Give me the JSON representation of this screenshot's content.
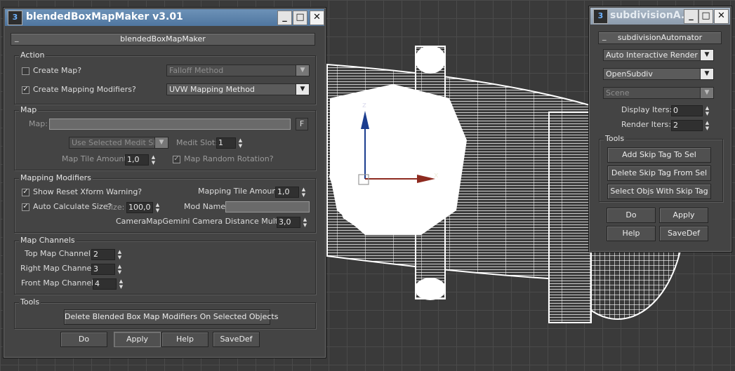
{
  "main_window": {
    "title": "blendedBoxMapMaker v3.01",
    "rollout": "blendedBoxMapMaker",
    "action": {
      "group": "Action",
      "create_map": {
        "label": "Create Map?",
        "checked": false
      },
      "create_mod": {
        "label": "Create Mapping Modifiers?",
        "checked": true
      },
      "falloff_method": "Falloff Method",
      "uvw_method": "UVW Mapping Method"
    },
    "map": {
      "group": "Map",
      "map_label": "Map:",
      "f_button": "F",
      "medit_dropdown": "Use Selected Medit Slot",
      "medit_slot_label": "Medit Slot:",
      "medit_slot_value": "1",
      "tile_label": "Map Tile Amount:",
      "tile_value": "1,0",
      "random_rot_label": "Map Random Rotation?",
      "random_rot_checked": true
    },
    "modifiers": {
      "group": "Mapping Modifiers",
      "reset_xform": {
        "label": "Show Reset Xform Warning?",
        "checked": true
      },
      "auto_calc": {
        "label": "Auto Calculate Size?",
        "checked": true
      },
      "tile_label": "Mapping Tile Amount:",
      "tile_value": "1,0",
      "size_label": "Size:",
      "size_value": "100,0",
      "mod_name_label": "Mod Name:",
      "camera_label": "CameraMapGemini Camera Distance Multiplier:",
      "camera_value": "3,0"
    },
    "channels": {
      "group": "Map Channels",
      "top_label": "Top Map Channel:",
      "top_value": "2",
      "right_label": "Right Map Channel:",
      "right_value": "3",
      "front_label": "Front Map Channel:",
      "front_value": "4"
    },
    "tools": {
      "group": "Tools",
      "delete_button": "Delete Blended Box Map Modifiers On Selected Objects"
    },
    "footer": {
      "do": "Do",
      "apply": "Apply",
      "help": "Help",
      "savedef": "SaveDef"
    }
  },
  "sub_window": {
    "title": "subdivisionA...",
    "rollout": "subdivisionAutomator",
    "dropdown1": "Auto Interactive Render On",
    "dropdown2": "OpenSubdiv",
    "dropdown3": "Scene",
    "display_iters_label": "Display Iters:",
    "display_iters_value": "0",
    "render_iters_label": "Render Iters:",
    "render_iters_value": "2",
    "tools_group": "Tools",
    "add_skip": "Add Skip Tag To Sel",
    "delete_skip": "Delete Skip Tag From Sel",
    "select_skip": "Select Objs With Skip Tag",
    "footer": {
      "do": "Do",
      "apply": "Apply",
      "help": "Help",
      "savedef": "SaveDef"
    }
  },
  "viewport": {
    "axis_z": "z",
    "axis_x": "x"
  },
  "window_buttons": {
    "minimize": "_",
    "maximize": "□",
    "close": "✕"
  },
  "colors": {
    "titlebar_active": "#5a80aa",
    "titlebar_inactive": "#9aa9ba",
    "panel": "#444444",
    "viewport_bg": "#3a3a3a"
  }
}
